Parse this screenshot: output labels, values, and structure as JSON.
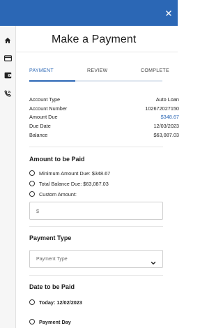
{
  "header": {
    "title": "Make a Payment"
  },
  "sidebar": {
    "icons": [
      "home-icon",
      "credit-card-icon",
      "wallet-icon",
      "phone-icon"
    ]
  },
  "tabs": [
    {
      "label": "PAYMENT",
      "active": true
    },
    {
      "label": "REVIEW",
      "active": false
    },
    {
      "label": "COMPLETE",
      "active": false
    }
  ],
  "details": [
    {
      "label": "Account Type",
      "value": "Auto Loan"
    },
    {
      "label": "Account Number",
      "value": "102672027150"
    },
    {
      "label": "Amount Due",
      "value": "$348.67"
    },
    {
      "label": "Due Date",
      "value": "12/03/2023"
    },
    {
      "label": "Balance",
      "value": "$63,087.03"
    }
  ],
  "amount_section": {
    "title": "Amount to be Paid",
    "options": [
      "Minimum Amount Due: $348.67",
      "Total Balance Due: $63,087.03",
      "Custom Amount:"
    ],
    "custom_placeholder": "$"
  },
  "payment_type": {
    "title": "Payment Type",
    "placeholder": "Payment Type"
  },
  "date_section": {
    "title": "Date to be Paid",
    "options": [
      "Today: 12/02/2023",
      "Payment Day"
    ]
  },
  "colors": {
    "brand": "#2b67b5",
    "accent_text": "#2b67b5"
  }
}
